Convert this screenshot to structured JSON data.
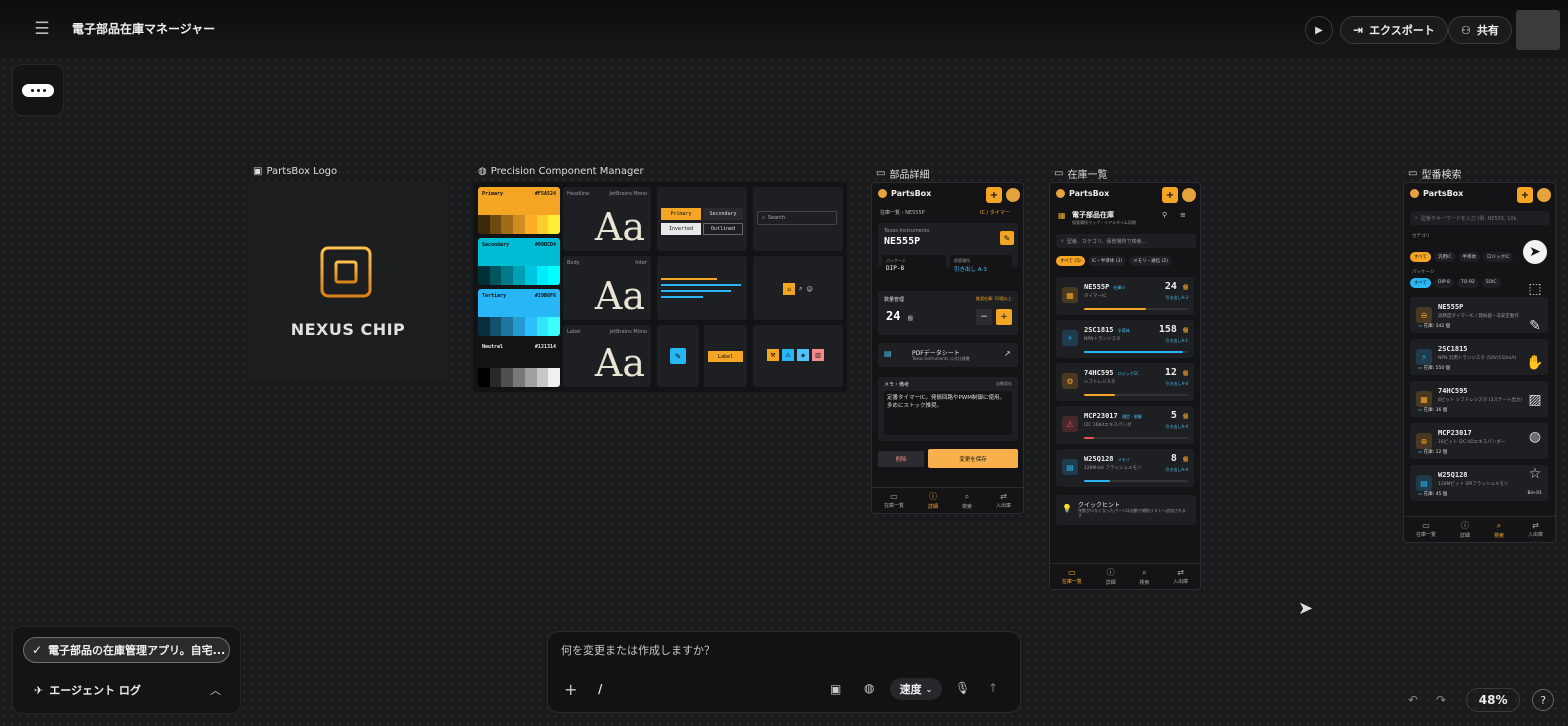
{
  "app": {
    "title": "電子部品在庫マネージャー"
  },
  "header": {
    "export_label": "エクスポート",
    "share_label": "共有"
  },
  "frames": {
    "logo": {
      "label": "PartsBox Logo",
      "logo_text": "NEXUS CHIP"
    },
    "design_system": {
      "label": "Precision Component Manager",
      "swatches": [
        {
          "name": "Primary",
          "hex": "#F5A524",
          "color": "#f5a524"
        },
        {
          "name": "Secondary",
          "hex": "#00BCD4",
          "color": "#00bcd4"
        },
        {
          "name": "Tertiary",
          "hex": "#29B6F6",
          "color": "#29b6f6"
        },
        {
          "name": "Neutral",
          "hex": "#121314",
          "color": "#121314"
        }
      ],
      "type_rows": [
        {
          "role": "Headline",
          "font": "JetBrains Mono",
          "sample": "Aa"
        },
        {
          "role": "Body",
          "font": "Inter",
          "sample": "Aa"
        },
        {
          "role": "Label",
          "font": "JetBrains Mono",
          "sample": "Aa"
        }
      ],
      "buttons": {
        "primary": "Primary",
        "secondary": "Secondary",
        "inverted": "Inverted",
        "outlined": "Outlined",
        "label": "Label"
      },
      "search_placeholder": "Search"
    },
    "detail": {
      "label": "部品詳細",
      "brand": "PartsBox",
      "breadcrumb": "在庫一覧 › NE555P",
      "category": "IC / タイマー",
      "maker": "Texas Instruments",
      "part": "NE555P",
      "package_label": "パッケージ",
      "package": "DIP-8",
      "location_label": "保管場所",
      "location": "引き出し A-3",
      "qty_label": "数量管理",
      "qty_hint": "推奨在庫: 10個以上",
      "qty": "24",
      "qty_unit": "個",
      "pdf_title": "PDFデータシート",
      "pdf_sub": "Texas Instruments 公式仕様書",
      "memo_label": "メモ・備考",
      "memo_hint": "自動保存",
      "memo": "定番タイマーIC。発振回路やPWM制御に使用。多めにストック推奨。",
      "delete": "削除",
      "save": "変更を保存"
    },
    "inventory": {
      "label": "在庫一覧",
      "brand": "PartsBox",
      "title": "電子部品在庫",
      "subtitle": "保管場所マップ・リアルタイム同期",
      "search_placeholder": "型番、カテゴリ、保管場所で検索...",
      "filters": [
        "すべて (5)",
        "IC・半導体 (3)",
        "メモリ・通信 (2)"
      ],
      "items": [
        {
          "part": "NE555P",
          "tag": "在庫少",
          "sub": "タイマーIC",
          "qty": "24",
          "unit": "個",
          "loc": "引き出しA-3",
          "icon": "chip-icon",
          "color": "#f5a524",
          "fill": 0.6
        },
        {
          "part": "2SC1815",
          "tag": "半導体",
          "sub": "NPNトランジスタ",
          "qty": "158",
          "unit": "個",
          "loc": "引き出しA-1",
          "icon": "bolt-icon",
          "color": "#29b6f6",
          "fill": 0.95
        },
        {
          "part": "74HC595",
          "tag": "ロジックIC",
          "sub": "シフトレジスタ",
          "qty": "12",
          "unit": "個",
          "loc": "引き出しA-4",
          "icon": "gear-icon",
          "color": "#f5a524",
          "fill": 0.3
        },
        {
          "part": "MCP23017",
          "tag": "通信・制御",
          "sub": "I2C 16bitエキスパンダ",
          "qty": "5",
          "unit": "個",
          "loc": "引き出しA-4",
          "icon": "warning-icon",
          "color": "#ef5350",
          "fill": 0.1
        },
        {
          "part": "W25Q128",
          "tag": "メモリ",
          "sub": "128M-bit フラッシュメモリ",
          "qty": "8",
          "unit": "個",
          "loc": "引き出しA-4",
          "icon": "memory-icon",
          "color": "#29b6f6",
          "fill": 0.25
        }
      ],
      "hint_title": "クイックヒント",
      "hint_text": "残数が少なくなったパーツは自動で補給リストへ追加されます"
    },
    "search": {
      "label": "型番検索",
      "brand": "PartsBox",
      "search_placeholder": "型番やキーワードを入力 (例: NE555, 10k",
      "category_label": "カテゴリ",
      "package_label": "パッケージ",
      "categories": [
        "すべて",
        "汎用IC",
        "半導体",
        "ロジックIC"
      ],
      "packages": [
        "すべて",
        "DIP-8",
        "TO-92",
        "SOIC"
      ],
      "results": [
        {
          "part": "NE555P",
          "sub": "高精度タイマーIC / 発振器・非安定動作",
          "stock": "在庫: 142 個"
        },
        {
          "part": "2SC1815",
          "sub": "NPN 汎用トランジスタ (50V/150mA)",
          "stock": "在庫: 550 個"
        },
        {
          "part": "74HC595",
          "sub": "8ビット シフトレジスタ (3ステート出力)",
          "stock": "在庫: 36 個"
        },
        {
          "part": "MCP23017",
          "sub": "16ビット I2C I/Oエキスパンダー",
          "stock": "在庫: 12 個"
        },
        {
          "part": "W25Q128",
          "sub": "128Mビット SPIフラッシュメモリ",
          "stock": "在庫: 45 個",
          "loc": "Bin-01"
        }
      ]
    },
    "nav": [
      "在庫一覧",
      "詳細",
      "検索",
      "入出庫"
    ]
  },
  "agent": {
    "status": "電子部品の在庫管理アプリ。自宅...",
    "log_label": "エージェント ログ"
  },
  "prompt": {
    "placeholder": "何を変更または作成しますか？",
    "slash": "/",
    "speed": "速度"
  },
  "zoom": {
    "level": "48%"
  }
}
